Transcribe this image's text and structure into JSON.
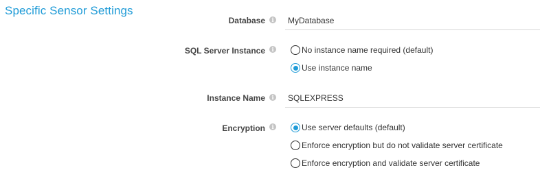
{
  "section": {
    "title": "Specific Sensor Settings"
  },
  "database": {
    "label": "Database",
    "value": "MyDatabase"
  },
  "sql_instance": {
    "label": "SQL Server Instance",
    "options": [
      {
        "label": "No instance name required (default)",
        "selected": false
      },
      {
        "label": "Use instance name",
        "selected": true
      }
    ]
  },
  "instance_name": {
    "label": "Instance Name",
    "value": "SQLEXPRESS"
  },
  "encryption": {
    "label": "Encryption",
    "options": [
      {
        "label": "Use server defaults (default)",
        "selected": true
      },
      {
        "label": "Enforce encryption but do not validate server certificate",
        "selected": false
      },
      {
        "label": "Enforce encryption and validate server certificate",
        "selected": false
      }
    ]
  },
  "colors": {
    "accent": "#1f9bd7",
    "info_icon": "#c4c4c4",
    "border": "#d8d8d8"
  },
  "icons": {
    "info": "info-icon"
  }
}
